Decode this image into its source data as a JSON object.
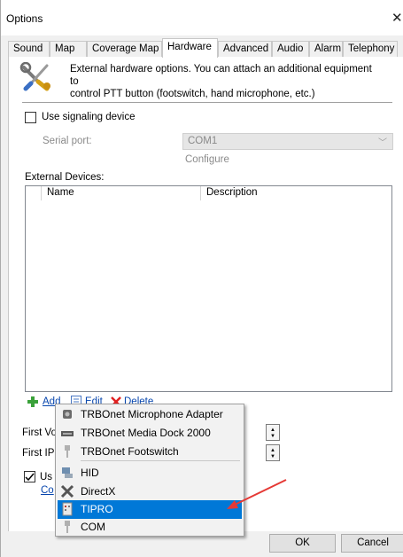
{
  "window": {
    "title": "Options",
    "close_glyph": "✕"
  },
  "tabs": [
    {
      "label": "Sound"
    },
    {
      "label": "Map"
    },
    {
      "label": "Coverage Map"
    },
    {
      "label": "Hardware"
    },
    {
      "label": "Advanced"
    },
    {
      "label": "Audio"
    },
    {
      "label": "Alarm"
    },
    {
      "label": "Telephony"
    }
  ],
  "active_tab": "Hardware",
  "header": {
    "icon": "tools-icon",
    "line1": "External hardware options. You can attach an additional equipment to",
    "line2": "control PTT button (footswitch, hand microphone, etc.)"
  },
  "signaling": {
    "checkbox_label": "Use signaling device",
    "checked": false,
    "serial_port_label": "Serial port:",
    "serial_port_value": "COM1",
    "configure_label": "Configure"
  },
  "devices": {
    "section_label": "External Devices:",
    "columns": [
      "Name",
      "Description"
    ],
    "rows": []
  },
  "toolbar": {
    "add_label": "Add",
    "edit_label": "Edit",
    "delete_label": "Delete"
  },
  "hidden_fields": {
    "first_vo_label": "First Vo",
    "first_ip_label": "First IP",
    "use_label": "Us",
    "config_link": "Co",
    "use_checked": true
  },
  "menu": {
    "items": [
      {
        "label": "TRBOnet Microphone Adapter",
        "icon": "microphone-adapter-icon",
        "selected": false
      },
      {
        "label": "TRBOnet Media Dock 2000",
        "icon": "media-dock-icon",
        "selected": false
      },
      {
        "label": "TRBOnet Footswitch",
        "icon": "footswitch-icon",
        "selected": false
      },
      {
        "label": "HID",
        "icon": "hid-icon",
        "selected": false
      },
      {
        "label": "DirectX",
        "icon": "directx-icon",
        "selected": false
      },
      {
        "label": "TIPRO",
        "icon": "tipro-icon",
        "selected": true
      },
      {
        "label": "COM",
        "icon": "com-icon",
        "selected": false
      }
    ]
  },
  "footer": {
    "ok_label": "OK",
    "cancel_label": "Cancel"
  },
  "colors": {
    "selection": "#0078d7",
    "link": "#0645ad",
    "annotation_arrow": "#e53935"
  }
}
